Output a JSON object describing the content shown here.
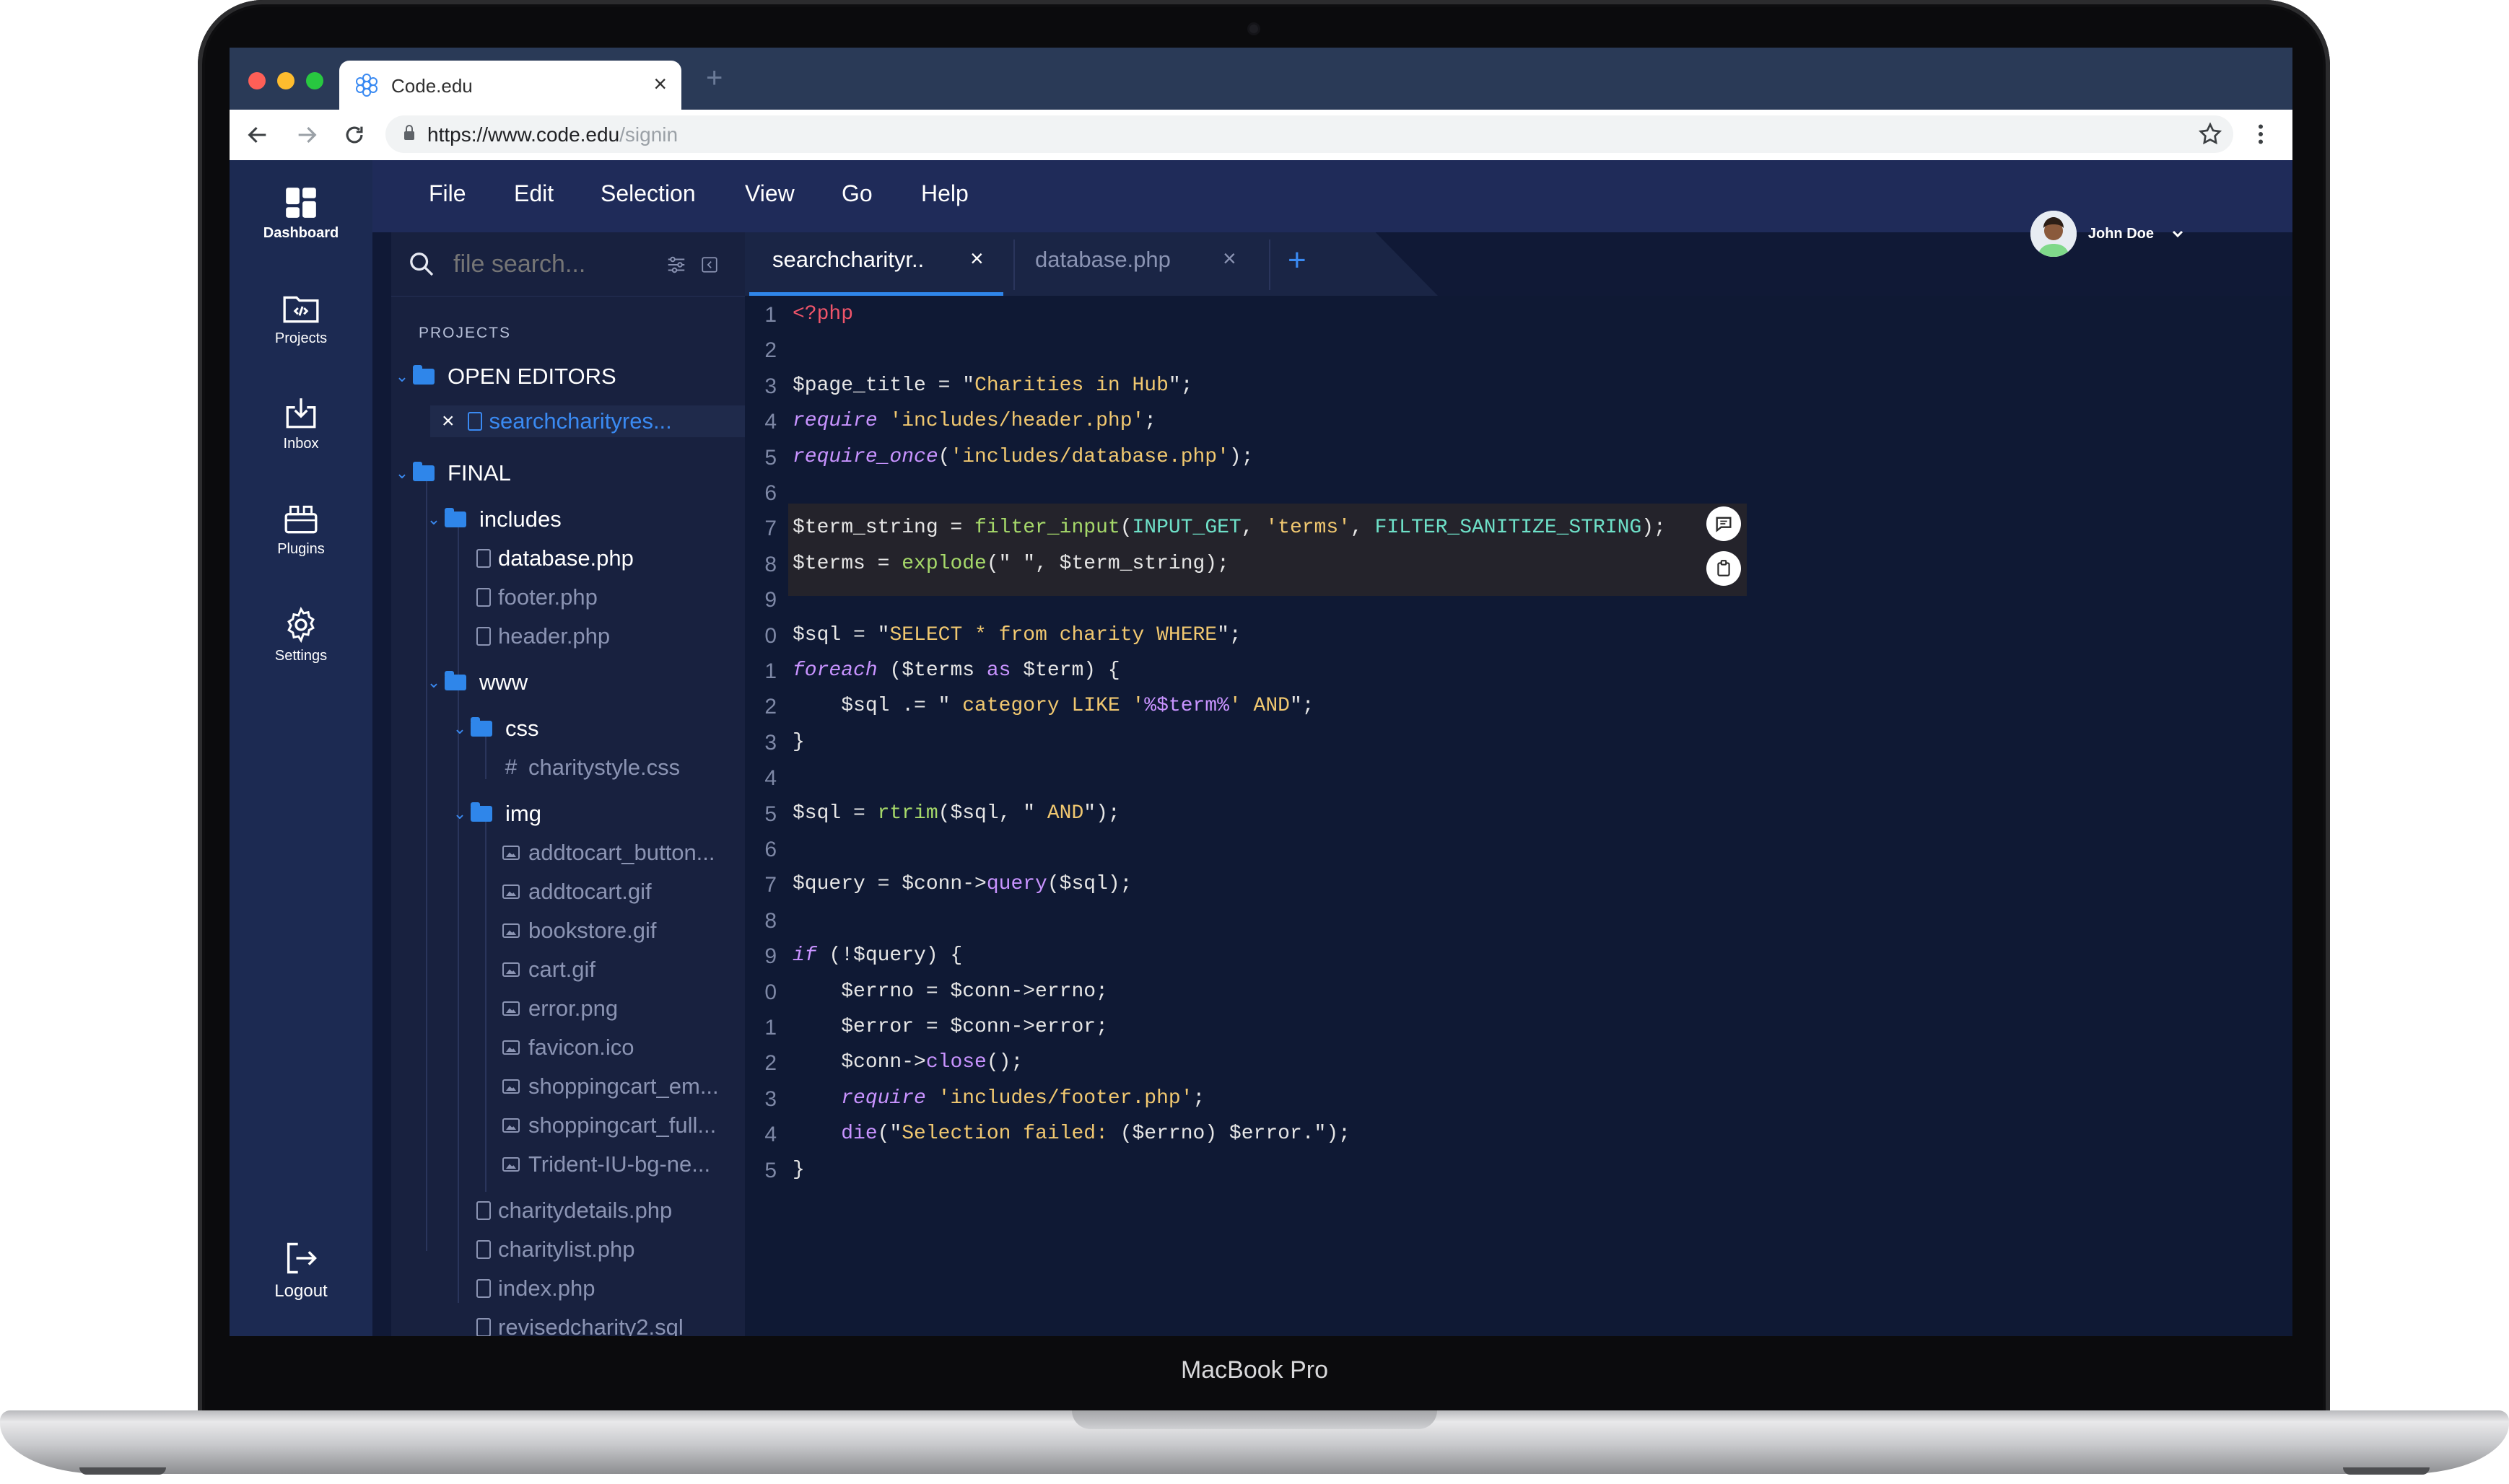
{
  "device": {
    "label": "MacBook Pro"
  },
  "browser": {
    "tab_title": "Code.edu",
    "new_tab_symbol": "+",
    "close_symbol": "×",
    "url_host": "https://www.code.edu",
    "url_path": "/signin",
    "traffic_lights": [
      "#fe5f57",
      "#febc2e",
      "#28c840"
    ],
    "icons": [
      "back-icon",
      "forward-icon",
      "reload-icon",
      "lock-icon",
      "star-icon",
      "more-icon"
    ]
  },
  "sidebar": {
    "items": [
      {
        "label": "Dashboard",
        "icon": "dashboard-icon"
      },
      {
        "label": "Projects",
        "icon": "projects-icon"
      },
      {
        "label": "Inbox",
        "icon": "inbox-icon"
      },
      {
        "label": "Plugins",
        "icon": "plugins-icon"
      },
      {
        "label": "Settings",
        "icon": "settings-icon"
      }
    ],
    "logout_label": "Logout"
  },
  "menu": {
    "items": [
      "File",
      "Edit",
      "Selection",
      "View",
      "Go",
      "Help"
    ]
  },
  "user": {
    "name": "John Doe"
  },
  "explorer": {
    "search_placeholder": "file search...",
    "projects_label": "PROJECTS",
    "tree": [
      {
        "type": "folder",
        "name": "OPEN EDITORS"
      },
      {
        "type": "open-file",
        "name": "searchcharityres..."
      },
      {
        "type": "folder",
        "name": "FINAL"
      },
      {
        "type": "folder",
        "name": "includes"
      },
      {
        "type": "file",
        "name": "database.php"
      },
      {
        "type": "file",
        "name": "footer.php"
      },
      {
        "type": "file",
        "name": "header.php"
      },
      {
        "type": "folder",
        "name": "www"
      },
      {
        "type": "folder",
        "name": "css"
      },
      {
        "type": "css",
        "name": "charitystyle.css"
      },
      {
        "type": "folder",
        "name": "img"
      },
      {
        "type": "image",
        "name": "addtocart_button..."
      },
      {
        "type": "image",
        "name": "addtocart.gif"
      },
      {
        "type": "image",
        "name": "bookstore.gif"
      },
      {
        "type": "image",
        "name": "cart.gif"
      },
      {
        "type": "image",
        "name": "error.png"
      },
      {
        "type": "image",
        "name": "favicon.ico"
      },
      {
        "type": "image",
        "name": "shoppingcart_em..."
      },
      {
        "type": "image",
        "name": "shoppingcart_full..."
      },
      {
        "type": "image",
        "name": "Trident-IU-bg-ne..."
      },
      {
        "type": "file",
        "name": "charitydetails.php"
      },
      {
        "type": "file",
        "name": "charitylist.php"
      },
      {
        "type": "file",
        "name": "index.php"
      },
      {
        "type": "file",
        "name": "revisedcharity2.sql"
      }
    ]
  },
  "editor_tabs": [
    {
      "label": "searchcharityr..",
      "active": true
    },
    {
      "label": "database.php",
      "active": false
    }
  ],
  "editor_add_symbol": "+",
  "colors": {
    "accent": "#2f86ea",
    "string": "#f1c870",
    "keyword": "#c893ff",
    "function": "#a6d96a",
    "constant": "#6ee0c8",
    "php_tag": "#f0556a"
  },
  "code_lines": [
    {
      "n": "1",
      "tokens": [
        [
          "<?php",
          "php_tag"
        ]
      ]
    },
    {
      "n": "2",
      "tokens": []
    },
    {
      "n": "3",
      "tokens": [
        [
          "$page_title = ",
          "text"
        ],
        [
          "\"",
          "text"
        ],
        [
          "Charities in Hub",
          "string"
        ],
        [
          "\";",
          "text"
        ]
      ]
    },
    {
      "n": "4",
      "tokens": [
        [
          "require",
          "keyword"
        ],
        [
          " ",
          "text"
        ],
        [
          "'includes/header.php'",
          "string"
        ],
        [
          ";",
          "text"
        ]
      ]
    },
    {
      "n": "5",
      "tokens": [
        [
          "require_once",
          "keyword"
        ],
        [
          "(",
          "text"
        ],
        [
          "'includes/database.php'",
          "string"
        ],
        [
          ");",
          "text"
        ]
      ]
    },
    {
      "n": "6",
      "tokens": []
    },
    {
      "n": "7",
      "tokens": [
        [
          "$term_string = ",
          "text"
        ],
        [
          "filter_input",
          "function"
        ],
        [
          "(",
          "text"
        ],
        [
          "INPUT_GET",
          "constant"
        ],
        [
          ", ",
          "text"
        ],
        [
          "'terms'",
          "string"
        ],
        [
          ", ",
          "text"
        ],
        [
          "FILTER_SANITIZE_STRING",
          "constant"
        ],
        [
          ");",
          "text"
        ]
      ]
    },
    {
      "n": "8",
      "tokens": [
        [
          "$terms = ",
          "text"
        ],
        [
          "explode",
          "function"
        ],
        [
          "(\" \", $term_string);",
          "text"
        ]
      ]
    },
    {
      "n": "9",
      "tokens": []
    },
    {
      "n": "0",
      "tokens": [
        [
          "$sql = ",
          "text"
        ],
        [
          "\"",
          "text"
        ],
        [
          "SELECT * from charity WHERE",
          "string"
        ],
        [
          "\";",
          "text"
        ]
      ]
    },
    {
      "n": "1",
      "tokens": [
        [
          "foreach",
          "keyword"
        ],
        [
          " ($terms ",
          "text"
        ],
        [
          "as",
          "keyword"
        ],
        [
          " $term) {",
          "text"
        ]
      ]
    },
    {
      "n": "2",
      "tokens": [
        [
          "    $sql .= \" ",
          "text"
        ],
        [
          "category LIKE '",
          "string"
        ],
        [
          "%$term%",
          "keyword"
        ],
        [
          "' AND",
          "string"
        ],
        [
          "\";",
          "text"
        ]
      ]
    },
    {
      "n": "3",
      "tokens": [
        [
          "}",
          "text"
        ]
      ]
    },
    {
      "n": "4",
      "tokens": []
    },
    {
      "n": "5",
      "tokens": [
        [
          "$sql = ",
          "text"
        ],
        [
          "rtrim",
          "function"
        ],
        [
          "($sql, \" ",
          "text"
        ],
        [
          "AND",
          "string"
        ],
        [
          "\");",
          "text"
        ]
      ]
    },
    {
      "n": "6",
      "tokens": []
    },
    {
      "n": "7",
      "tokens": [
        [
          "$query = $conn->",
          "text"
        ],
        [
          "query",
          "keyword"
        ],
        [
          "($sql);",
          "text"
        ]
      ]
    },
    {
      "n": "8",
      "tokens": []
    },
    {
      "n": "9",
      "tokens": [
        [
          "if",
          "keyword"
        ],
        [
          " (!$query) {",
          "text"
        ]
      ]
    },
    {
      "n": "0",
      "tokens": [
        [
          "    $errno = $conn->errno;",
          "text"
        ]
      ]
    },
    {
      "n": "1",
      "tokens": [
        [
          "    $error = $conn->error;",
          "text"
        ]
      ]
    },
    {
      "n": "2",
      "tokens": [
        [
          "    $conn->",
          "text"
        ],
        [
          "close",
          "keyword"
        ],
        [
          "();",
          "text"
        ]
      ]
    },
    {
      "n": "3",
      "tokens": [
        [
          "    ",
          "text"
        ],
        [
          "require",
          "keyword"
        ],
        [
          " ",
          "text"
        ],
        [
          "'includes/footer.php'",
          "string"
        ],
        [
          ";",
          "text"
        ]
      ]
    },
    {
      "n": "4",
      "tokens": [
        [
          "    ",
          "text"
        ],
        [
          "die",
          "keyword"
        ],
        [
          "(\"",
          "text"
        ],
        [
          "Selection failed: ",
          "string"
        ],
        [
          "($errno) $error.",
          "text"
        ],
        [
          "\");",
          "text"
        ]
      ]
    },
    {
      "n": "5",
      "tokens": [
        [
          "}",
          "text"
        ]
      ]
    }
  ]
}
